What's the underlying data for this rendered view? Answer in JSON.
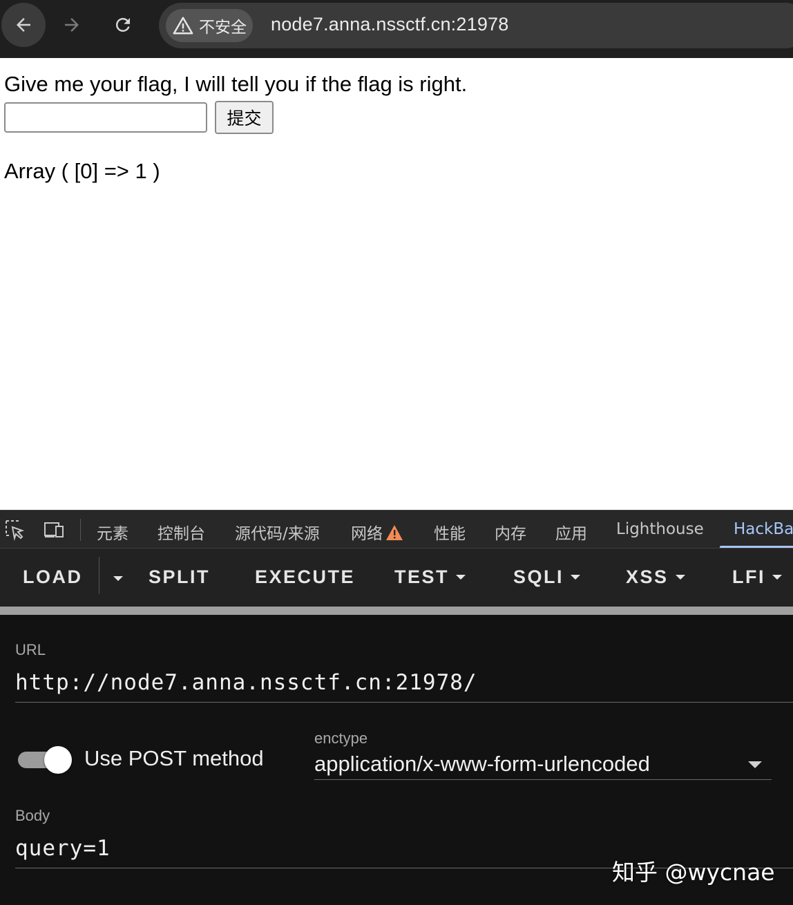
{
  "browser": {
    "security_label": "不安全",
    "url": "node7.anna.nssctf.cn:21978"
  },
  "page": {
    "prompt": "Give me your flag, I will tell you if the flag is right.",
    "input_value": "",
    "submit_label": "提交",
    "result": "Array ( [0] => 1 )"
  },
  "devtools": {
    "tabs": [
      "元素",
      "控制台",
      "源代码/来源",
      "网络",
      "性能",
      "内存",
      "应用",
      "Lighthouse",
      "HackBa"
    ],
    "active_tab": "HackBa",
    "network_warning_color": "#f28b54"
  },
  "hackbar": {
    "menu": {
      "load": "LOAD",
      "split": "SPLIT",
      "execute": "EXECUTE",
      "test": "TEST",
      "sqli": "SQLI",
      "xss": "XSS",
      "lfi": "LFI"
    },
    "url_label": "URL",
    "url_value": "http://node7.anna.nssctf.cn:21978/",
    "post_label": "Use POST method",
    "post_enabled": true,
    "enctype_label": "enctype",
    "enctype_value": "application/x-www-form-urlencoded",
    "body_label": "Body",
    "body_value": "query=1"
  },
  "watermark": "知乎 @wycnae"
}
